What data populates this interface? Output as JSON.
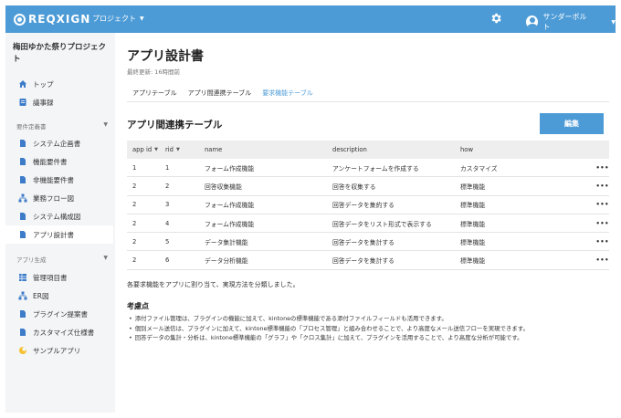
{
  "header": {
    "logo_text": "REQXIGN",
    "project_menu": "プロジェクト",
    "user_name": "サンダーボルト"
  },
  "sidebar": {
    "project_name": "梅田ゆかた祭りプロジェクト",
    "top_items": [
      {
        "label": "トップ",
        "icon": "home-icon"
      },
      {
        "label": "議事録",
        "icon": "minutes-icon"
      }
    ],
    "sections": [
      {
        "title": "要件定義書",
        "items": [
          {
            "label": "システム企画書",
            "icon": "document-icon"
          },
          {
            "label": "機能要件書",
            "icon": "document-icon"
          },
          {
            "label": "非機能要件書",
            "icon": "document-icon"
          },
          {
            "label": "業務フロー図",
            "icon": "flow-icon"
          },
          {
            "label": "システム構成図",
            "icon": "document-icon"
          },
          {
            "label": "アプリ設計書",
            "icon": "document-icon",
            "active": true
          }
        ]
      },
      {
        "title": "アプリ生成",
        "items": [
          {
            "label": "管理項目書",
            "icon": "grid-icon"
          },
          {
            "label": "ER図",
            "icon": "flow-icon"
          },
          {
            "label": "プラグイン提案書",
            "icon": "document-icon"
          },
          {
            "label": "カスタマイズ仕様書",
            "icon": "document-icon"
          },
          {
            "label": "サンプルアプリ",
            "icon": "sample-app-icon"
          }
        ]
      }
    ]
  },
  "main": {
    "title": "アプリ設計書",
    "last_updated": "最終更新: 16時間前",
    "tabs": [
      {
        "label": "アプリテーブル",
        "active": false
      },
      {
        "label": "アプリ間連携テーブル",
        "active": false
      },
      {
        "label": "要求機能テーブル",
        "active": true
      }
    ],
    "section_title": "アプリ間連携テーブル",
    "edit_button": "編集",
    "table": {
      "headers": [
        "app id",
        "rid",
        "name",
        "description",
        "how"
      ],
      "rows": [
        [
          "1",
          "1",
          "フォーム作成機能",
          "アンケートフォームを作成する",
          "カスタマイズ"
        ],
        [
          "2",
          "2",
          "回答収集機能",
          "回答を収集する",
          "標準機能"
        ],
        [
          "2",
          "3",
          "フォーム作成機能",
          "回答データを集約する",
          "標準機能"
        ],
        [
          "2",
          "4",
          "フォーム作成機能",
          "回答データをリスト形式で表示する",
          "標準機能"
        ],
        [
          "2",
          "5",
          "データ集計機能",
          "回答データを集計する",
          "標準機能"
        ],
        [
          "2",
          "6",
          "データ分析機能",
          "回答データを集計する",
          "標準機能"
        ]
      ],
      "row_menu": "•••"
    },
    "description": "各要求機能をアプリに割り当て、実現方法を分類しました。",
    "considerations_title": "考慮点",
    "considerations": [
      "添付ファイル管理は、プラグインの機能に加えて、kintoneの標準機能である添付ファイルフィールドも活用できます。",
      "個別メール送信は、プラグインに加えて、kintone標準機能の「プロセス管理」と組み合わせることで、より高度なメール送信フローを実現できます。",
      "回答データの集計・分析は、kintone標準機能の「グラフ」や「クロス集計」に加えて、プラグインを活用することで、より高度な分析が可能です。"
    ]
  },
  "colors": {
    "accent": "#4d9bd6",
    "sidebar_bg": "#f4f5f7",
    "table_header_bg": "#eeeeee"
  }
}
